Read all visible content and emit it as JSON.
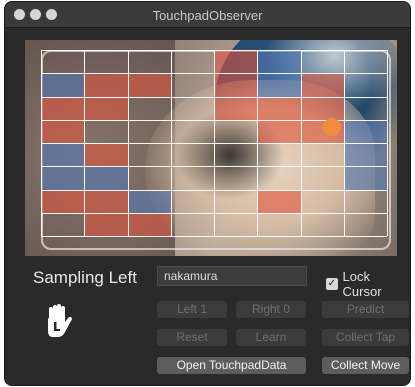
{
  "window": {
    "title": "TouchpadObserver"
  },
  "status": {
    "label": "Sampling Left"
  },
  "name_field": {
    "value": "nakamura"
  },
  "lock_cursor": {
    "label": "Lock Cursor",
    "checked": true
  },
  "buttons": {
    "left": "Left 1",
    "right": "Right 0",
    "predict": "Predict",
    "reset": "Reset",
    "learn": "Learn",
    "collect_tap": "Collect Tap",
    "open_data": "Open TouchpadData",
    "collect_move": "Collect Move"
  },
  "grid": {
    "rows": 8,
    "cols": 8,
    "heat": [
      [
        "n",
        "n",
        "n",
        "n",
        "r",
        "b",
        "n",
        "n"
      ],
      [
        "b",
        "r",
        "r",
        "n",
        "r",
        "b",
        "r",
        "n"
      ],
      [
        "r",
        "r",
        "n",
        "n",
        "r",
        "r",
        "r",
        "n"
      ],
      [
        "r",
        "n",
        "n",
        "n",
        "n",
        "r",
        "r",
        "b"
      ],
      [
        "b",
        "r",
        "n",
        "n",
        "n",
        "n",
        "n",
        "b"
      ],
      [
        "b",
        "b",
        "n",
        "n",
        "n",
        "n",
        "n",
        "b"
      ],
      [
        "r",
        "r",
        "b",
        "n",
        "n",
        "r",
        "n",
        "n"
      ],
      [
        "n",
        "r",
        "r",
        "n",
        "n",
        "n",
        "n",
        "n"
      ]
    ]
  },
  "colors": {
    "heat_red": "#e0553f",
    "heat_blue": "#5478b4",
    "touch_point": "#f08c3c"
  }
}
